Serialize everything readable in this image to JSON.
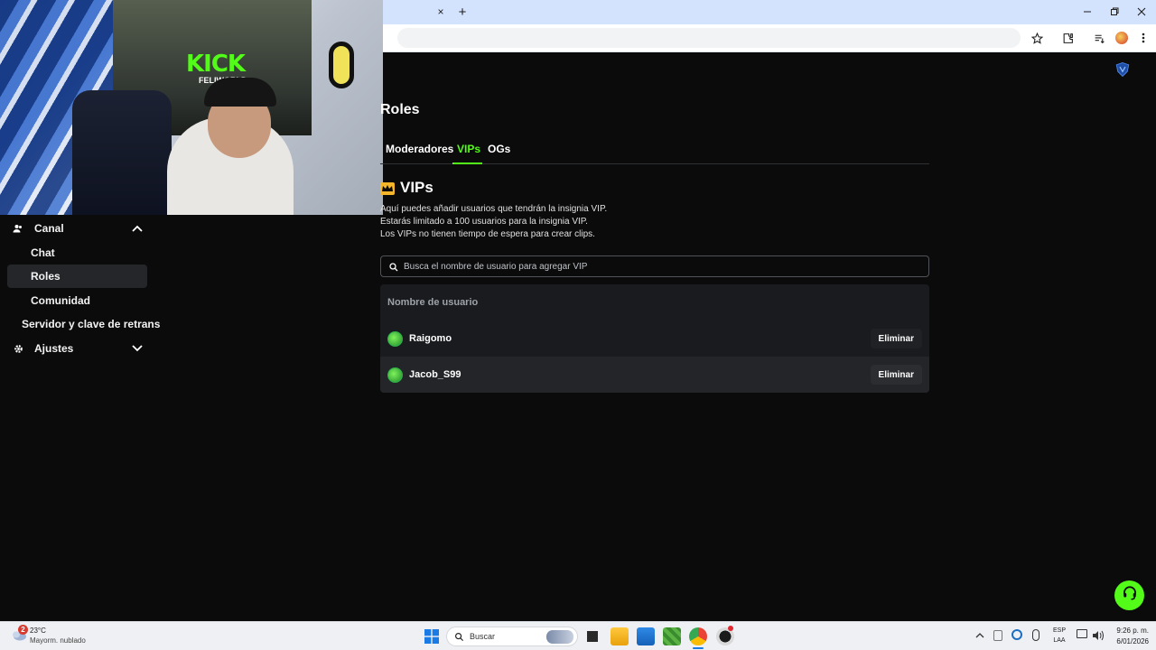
{
  "browser": {
    "tab_close": "×",
    "new_tab": "+",
    "window_controls": [
      "minimize-icon",
      "restore-icon",
      "close-icon"
    ]
  },
  "sidebar": {
    "sections": [
      {
        "label": "Canal",
        "icon": "users-icon",
        "expanded": true
      },
      {
        "label": "Ajustes",
        "icon": "gear-icon",
        "expanded": false
      }
    ],
    "items": [
      {
        "label": "Chat"
      },
      {
        "label": "Roles",
        "active": true
      },
      {
        "label": "Comunidad"
      },
      {
        "label": "Servidor y clave de retrans"
      }
    ]
  },
  "page": {
    "title": "Roles",
    "tabs": [
      {
        "label": "Moderadores"
      },
      {
        "label": "VIPs",
        "active": true
      },
      {
        "label": "OGs"
      }
    ],
    "section_title": "VIPs",
    "description": [
      "Aquí puedes añadir usuarios que tendrán la insignia VIP.",
      "Estarás limitado a 100 usuarios para la insignia VIP.",
      "Los VIPs no tienen tiempo de espera para crear clips."
    ],
    "search_placeholder": "Busca el nombre de usuario para agregar VIP",
    "table": {
      "header": "Nombre de usuario",
      "rows": [
        {
          "username": "Raigomo",
          "action": "Eliminar"
        },
        {
          "username": "Jacob_S99",
          "action": "Eliminar"
        }
      ]
    }
  },
  "webcam": {
    "brand_text": "KICK",
    "sub_text": "FELIWORLD"
  },
  "taskbar": {
    "weather_temp": "23°C",
    "weather_desc": "Mayorm. nublado",
    "weather_badge": "2",
    "search_label": "Buscar",
    "lang_top": "ESP",
    "lang_bottom": "LAA",
    "time": "9:26 p. m.",
    "date": "6/01/2026"
  },
  "colors": {
    "accent": "#53fc18",
    "background": "#0b0b0c",
    "table_bg": "#191b1e"
  }
}
